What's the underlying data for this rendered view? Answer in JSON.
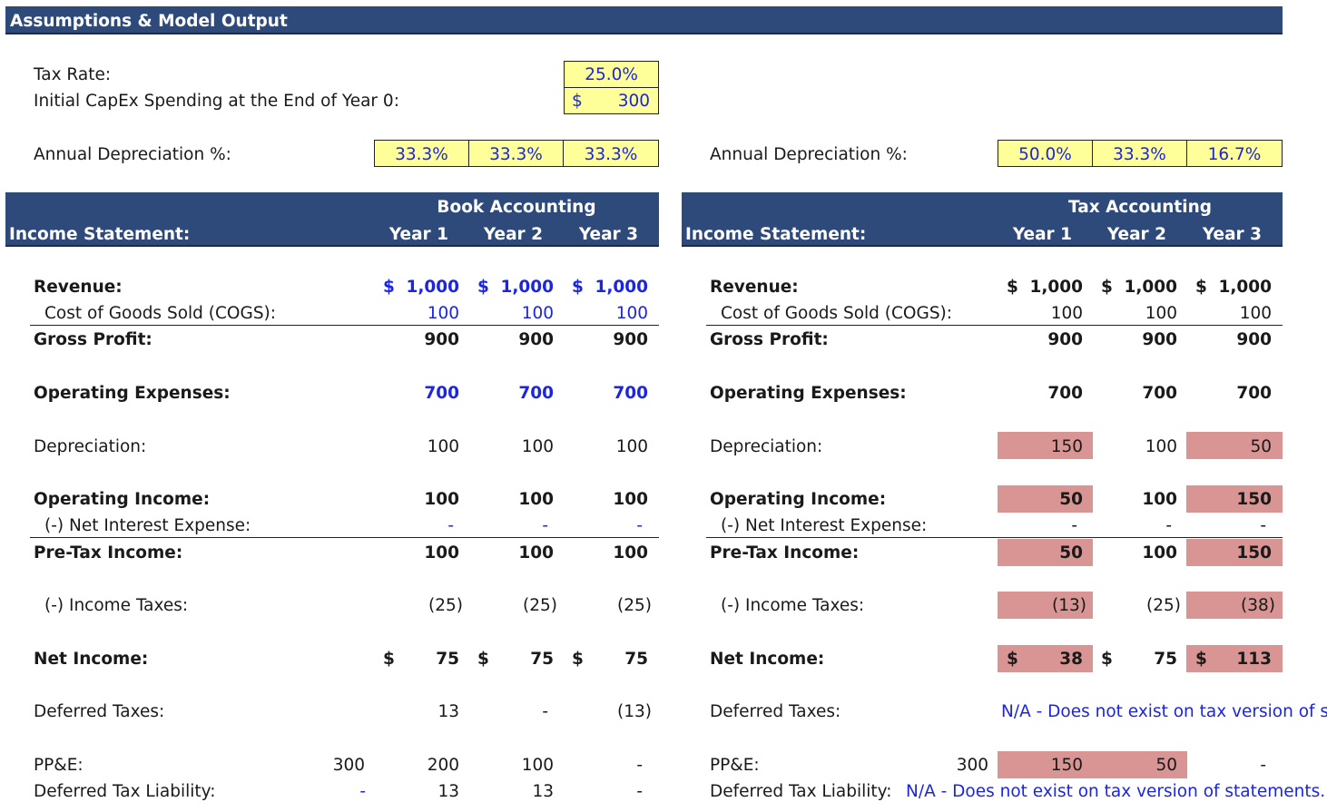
{
  "header": {
    "title": "Assumptions & Model Output"
  },
  "assumptions": {
    "tax_rate_label": "Tax Rate:",
    "tax_rate_value": "25.0%",
    "capex_label": "Initial CapEx Spending at the End of Year 0:",
    "capex_currency": "$",
    "capex_value": "300",
    "book_dep_label": "Annual Depreciation %:",
    "book_dep": [
      "33.3%",
      "33.3%",
      "33.3%"
    ],
    "tax_dep_label": "Annual Depreciation %:",
    "tax_dep": [
      "50.0%",
      "33.3%",
      "16.7%"
    ]
  },
  "book": {
    "section_title": "Book Accounting",
    "is_label": "Income Statement:",
    "years": [
      "Year 1",
      "Year 2",
      "Year 3"
    ],
    "rows": {
      "revenue": {
        "label": "Revenue:",
        "cur": "$",
        "values": [
          "1,000",
          "1,000",
          "1,000"
        ]
      },
      "cogs": {
        "label": "Cost of Goods Sold (COGS):",
        "values": [
          "100",
          "100",
          "100"
        ]
      },
      "gross": {
        "label": "Gross Profit:",
        "values": [
          "900",
          "900",
          "900"
        ]
      },
      "opex": {
        "label": "Operating Expenses:",
        "values": [
          "700",
          "700",
          "700"
        ]
      },
      "dep": {
        "label": "Depreciation:",
        "values": [
          "100",
          "100",
          "100"
        ]
      },
      "opinc": {
        "label": "Operating Income:",
        "values": [
          "100",
          "100",
          "100"
        ]
      },
      "interest": {
        "label": "(-) Net Interest Expense:",
        "values": [
          "-",
          "-",
          "-"
        ]
      },
      "pretax": {
        "label": "Pre-Tax Income:",
        "values": [
          "100",
          "100",
          "100"
        ]
      },
      "taxes": {
        "label": "(-) Income Taxes:",
        "values": [
          "(25)",
          "(25)",
          "(25)"
        ]
      },
      "net": {
        "label": "Net Income:",
        "cur": "$",
        "values": [
          "75",
          "75",
          "75"
        ]
      },
      "deferred": {
        "label": "Deferred Taxes:",
        "values": [
          "13",
          "-",
          "(13)"
        ]
      },
      "ppe": {
        "label": "PP&E:",
        "year0": "300",
        "values": [
          "200",
          "100",
          "-"
        ]
      },
      "dtl": {
        "label": "Deferred Tax Liability:",
        "year0": "-",
        "values": [
          "13",
          "13",
          "-"
        ]
      }
    }
  },
  "tax": {
    "section_title": "Tax Accounting",
    "is_label": "Income Statement:",
    "years": [
      "Year 1",
      "Year 2",
      "Year 3"
    ],
    "rows": {
      "revenue": {
        "label": "Revenue:",
        "cur": "$",
        "values": [
          "1,000",
          "1,000",
          "1,000"
        ]
      },
      "cogs": {
        "label": "Cost of Goods Sold (COGS):",
        "values": [
          "100",
          "100",
          "100"
        ]
      },
      "gross": {
        "label": "Gross Profit:",
        "values": [
          "900",
          "900",
          "900"
        ]
      },
      "opex": {
        "label": "Operating Expenses:",
        "values": [
          "700",
          "700",
          "700"
        ]
      },
      "dep": {
        "label": "Depreciation:",
        "values": [
          "150",
          "100",
          "50"
        ]
      },
      "opinc": {
        "label": "Operating Income:",
        "values": [
          "50",
          "100",
          "150"
        ]
      },
      "interest": {
        "label": "(-) Net Interest Expense:",
        "values": [
          "-",
          "-",
          "-"
        ]
      },
      "pretax": {
        "label": "Pre-Tax Income:",
        "values": [
          "50",
          "100",
          "150"
        ]
      },
      "taxes": {
        "label": "(-) Income Taxes:",
        "values": [
          "(13)",
          "(25)",
          "(38)"
        ]
      },
      "net": {
        "label": "Net Income:",
        "cur": "$",
        "values": [
          "38",
          "75",
          "113"
        ]
      },
      "deferred": {
        "label": "Deferred Taxes:",
        "note": "N/A - Does not exist on tax version of s"
      },
      "ppe": {
        "label": "PP&E:",
        "year0": "300",
        "values": [
          "150",
          "50",
          "-"
        ]
      },
      "dtl": {
        "label": "Deferred Tax Liability:",
        "note": "N/A - Does not exist on tax version of statements."
      }
    }
  },
  "colors": {
    "header_band": "#2e4a7a",
    "input_fill": "#ffff99",
    "highlight": "#d99594",
    "input_text": "#1c25e0"
  }
}
